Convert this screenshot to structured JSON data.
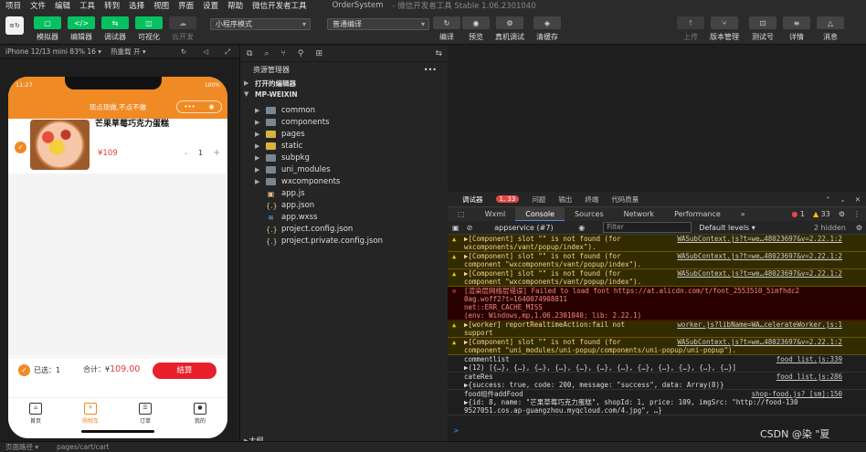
{
  "menubar": {
    "items": [
      "项目",
      "文件",
      "编辑",
      "工具",
      "转到",
      "选择",
      "视图",
      "界面",
      "设置",
      "帮助",
      "微信开发者工具"
    ],
    "app_title": "OrderSystem",
    "app_sub": "- 微信开发者工具 Stable 1.06.2301040"
  },
  "toolbar": {
    "logo": "≡↻",
    "left_buttons": [
      {
        "label": "模拟器",
        "icon": "▢"
      },
      {
        "label": "编辑器",
        "icon": "</>"
      },
      {
        "label": "调试器",
        "icon": "⇆"
      },
      {
        "label": "可视化",
        "icon": "◫"
      },
      {
        "label": "云开发",
        "icon": "☁"
      }
    ],
    "mode_select": "小程序模式",
    "compile_select": "普通编译",
    "mid_buttons": [
      {
        "label": "编译",
        "icon": "↻"
      },
      {
        "label": "预览",
        "icon": "◉"
      },
      {
        "label": "真机调试",
        "icon": "⚙"
      },
      {
        "label": "清缓存",
        "icon": "◈"
      }
    ],
    "right_buttons": [
      {
        "label": "上传",
        "icon": "↑"
      },
      {
        "label": "版本管理",
        "icon": "⑂"
      },
      {
        "label": "测试号",
        "icon": "⊡"
      },
      {
        "label": "详情",
        "icon": "≡"
      },
      {
        "label": "消息",
        "icon": "△"
      }
    ]
  },
  "simulator": {
    "device": "iPhone 12/13 mini 83% 16 ▾",
    "hot_reload": "热重载 开 ▾",
    "phone": {
      "time": "11:27",
      "battery": "100%",
      "nav_title": "现点现做,不点不做",
      "item_name": "芒果草莓巧克力蛋糕",
      "item_price": "¥109",
      "item_minus": "-",
      "item_qty": "1",
      "item_plus": "+",
      "selected_label": "已选：1",
      "total_prefix": "合计：¥",
      "total_value": "109.00",
      "pay_label": "结算",
      "tabs": [
        {
          "label": "首页",
          "icon": "⌂"
        },
        {
          "label": "购物车",
          "icon": "¥"
        },
        {
          "label": "订单",
          "icon": "☰"
        },
        {
          "label": "我的",
          "icon": "●"
        }
      ]
    }
  },
  "status": {
    "path_label": "页面路径 ▾",
    "path": "pages/cart/cart"
  },
  "explorer": {
    "title": "资源管理器",
    "open_editors": "打开的编辑器",
    "project": "MP-WEIXIN",
    "entries": [
      {
        "name": "common",
        "type": "folder"
      },
      {
        "name": "components",
        "type": "folder"
      },
      {
        "name": "pages",
        "type": "folder-y"
      },
      {
        "name": "static",
        "type": "folder-y"
      },
      {
        "name": "subpkg",
        "type": "folder"
      },
      {
        "name": "uni_modules",
        "type": "folder"
      },
      {
        "name": "wxcomponents",
        "type": "folder"
      },
      {
        "name": "app.js",
        "type": "js"
      },
      {
        "name": "app.json",
        "type": "json"
      },
      {
        "name": "app.wxss",
        "type": "wxss"
      },
      {
        "name": "project.config.json",
        "type": "json"
      },
      {
        "name": "project.private.config.json",
        "type": "json"
      }
    ],
    "outline": "大纲"
  },
  "devtools": {
    "tabs": [
      "调试器",
      "问题",
      "输出",
      "终端",
      "代码质量"
    ],
    "badge": "1, 33",
    "chrome_tabs": [
      "Wxml",
      "Console",
      "Sources",
      "Network",
      "Performance",
      "»"
    ],
    "err_count": "1",
    "warn_count": "33",
    "context": "appservice (#7)",
    "filter_placeholder": "Filter",
    "levels": "Default levels ▾",
    "hidden": "2 hidden",
    "logs": [
      {
        "type": "warn",
        "text": "▶[Component] slot \"\" is not found (for \nwxcomponents/vant/popup/index\").",
        "src": "WASubContext.js?t=we…48023697&v=2.22.1:2"
      },
      {
        "type": "warn",
        "text": "▶[Component] slot \"\" is not found (for \ncomponent \"wxcomponents/vant/popup/index\").",
        "src": "WASubContext.js?t=we…48023697&v=2.22.1:2"
      },
      {
        "type": "warn",
        "text": "▶[Component] slot \"\" is not found (for \ncomponent \"wxcomponents/vant/popup/index\").",
        "src": "WASubContext.js?t=we…48023697&v=2.22.1:2"
      },
      {
        "type": "err",
        "text": "[渲染层网络层错误] Failed to load font https://at.alicdn.com/t/font_2553510_5imfhdc2\n0ag.woff2?t=1640074908811\nnet::ERR_CACHE_MISS\n(env: Windows,mp,1.06.2301040; lib: 2.22.1)",
        "src": ""
      },
      {
        "type": "warn",
        "text": "▶[worker] reportRealtimeAction:fail not \nsupport",
        "src": "worker.js?libName=WA…celerateWorker.js:1"
      },
      {
        "type": "warn",
        "text": "▶[Component] slot \"\" is not found (for \ncomponent \"uni_modules/uni-popup/components/uni-popup/uni-popup\").",
        "src": "WASubContext.js?t=we…48023697&v=2.22.1:2"
      },
      {
        "type": "info",
        "text": "commentlist\n▶(12) [{…}, {…}, {…}, {…}, {…}, {…}, {…}, {…}, {…}, {…}, {…}, {…}]",
        "src": "food list.js:339"
      },
      {
        "type": "info",
        "text": "cateRes\n▶{success: true, code: 200, message: \"success\", data: Array(8)}",
        "src": "food list.js:286"
      },
      {
        "type": "info",
        "text": "food组件addFood\n▶{id: 8, name: \"芒果草莓巧克力蛋糕\", shopId: 1, price: 109, imgSrc: \"http://food-130\n9527051.cos.ap-guangzhou.myqcloud.com/4.jpg\", …}",
        "src": "shop-food.js? [sm]:150"
      }
    ],
    "prompt": ">"
  },
  "watermark": "CSDN @染 \"夏"
}
